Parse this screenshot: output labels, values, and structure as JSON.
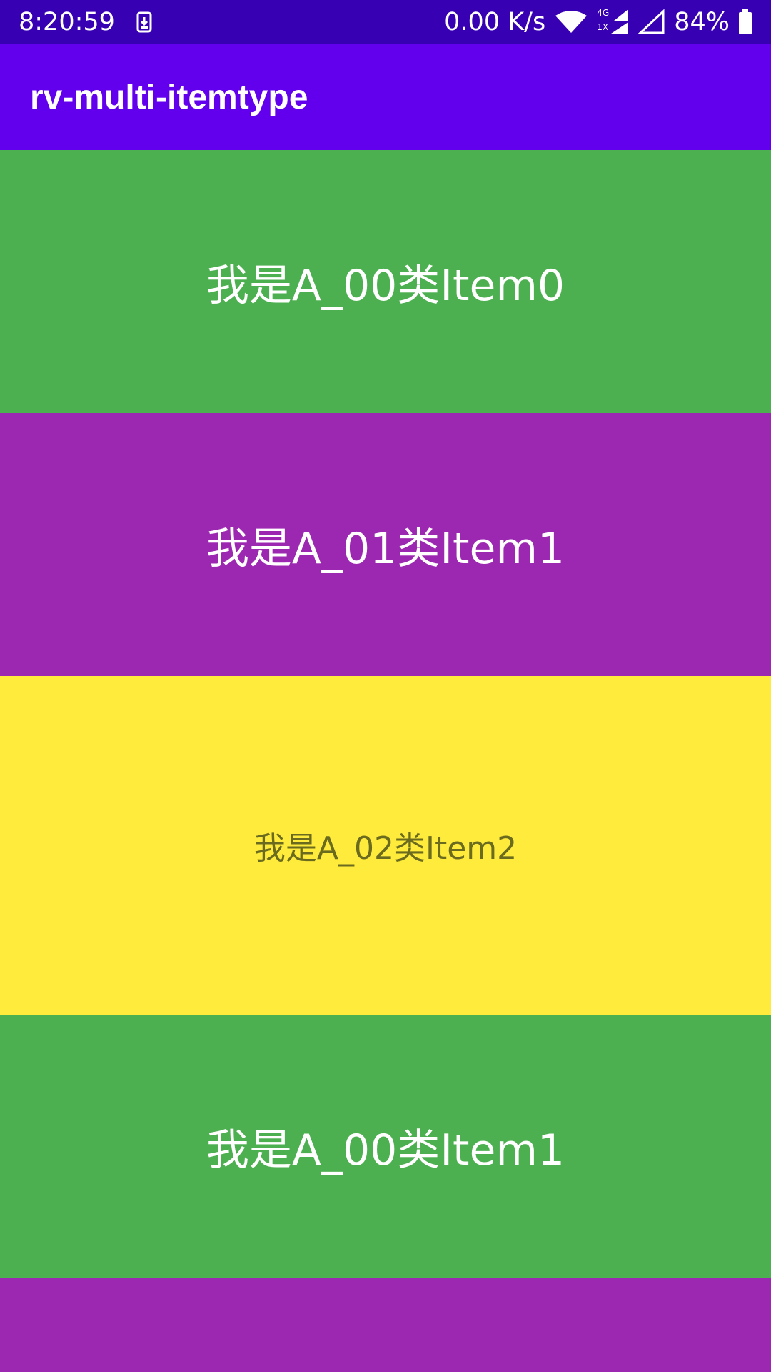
{
  "status_bar": {
    "time": "8:20:59",
    "net_speed": "0.00 K/s",
    "network_label_top": "4G",
    "network_label_bottom": "1X",
    "battery": "84%",
    "icons": [
      "download-notification-icon",
      "wifi-icon",
      "signal-icon",
      "signal-empty-icon",
      "battery-icon"
    ]
  },
  "app_bar": {
    "title": "rv-multi-itemtype"
  },
  "list": {
    "items": [
      {
        "type": "A_00",
        "label": "我是A_00类Item0",
        "color": "#4caf50"
      },
      {
        "type": "A_01",
        "label": "我是A_01类Item1",
        "color": "#9c27b0"
      },
      {
        "type": "A_02",
        "label": "我是A_02类Item2",
        "color": "#ffeb3b"
      },
      {
        "type": "A_00",
        "label": "我是A_00类Item1",
        "color": "#4caf50"
      },
      {
        "type": "A_01",
        "label": "",
        "color": "#9c27b0"
      }
    ]
  }
}
